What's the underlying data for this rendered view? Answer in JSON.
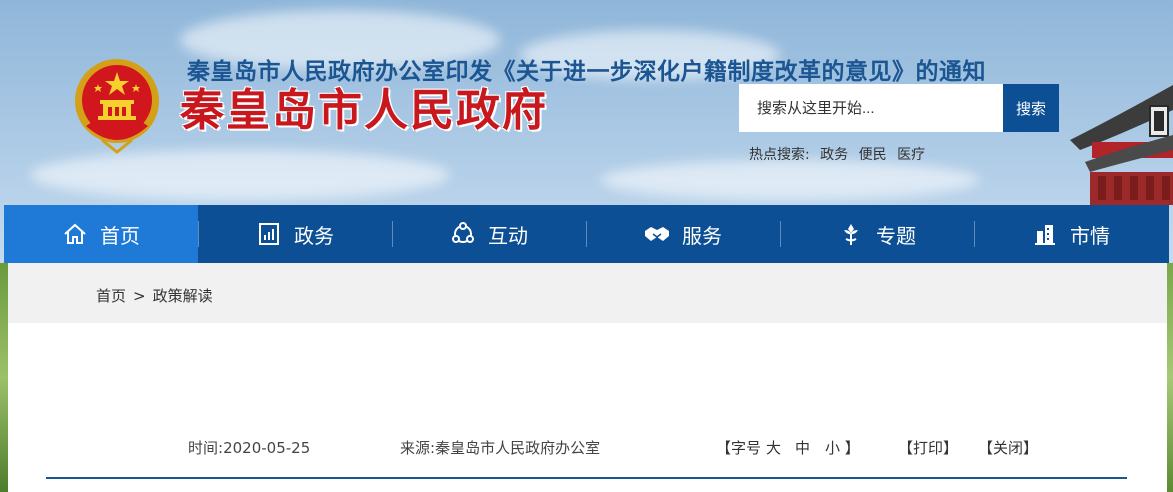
{
  "header": {
    "site_title": "秦皇岛市人民政府",
    "search_placeholder": "搜索从这里开始...",
    "search_button": "搜索",
    "hot_label": "热点搜索:",
    "hot_links": [
      "政务",
      "便民",
      "医疗"
    ]
  },
  "nav": {
    "items": [
      {
        "label": "首页",
        "icon": "home-icon",
        "active": true
      },
      {
        "label": "政务",
        "icon": "bar-chart-icon",
        "active": false
      },
      {
        "label": "互动",
        "icon": "interaction-icon",
        "active": false
      },
      {
        "label": "服务",
        "icon": "handshake-icon",
        "active": false
      },
      {
        "label": "专题",
        "icon": "flower-icon",
        "active": false
      },
      {
        "label": "市情",
        "icon": "building-icon",
        "active": false
      }
    ]
  },
  "breadcrumb": {
    "home": "首页",
    "separator": ">",
    "current": "政策解读"
  },
  "article": {
    "title": "秦皇岛市人民政府办公室印发《关于进一步深化户籍制度改革的意见》的通知",
    "time_label": "时间:",
    "time_value": "2020-05-25",
    "source_label": "来源:",
    "source_value": "秦皇岛市人民政府办公室",
    "font_size_label": "【字号",
    "font_large": "大",
    "font_medium": "中",
    "font_small": "小 】",
    "print_label": "【打印】",
    "close_label": "【关闭】"
  },
  "colors": {
    "nav_bg": "#0d4f94",
    "nav_active": "#1e7ad6",
    "title_red": "#c8171d",
    "article_title": "#1b5592"
  }
}
